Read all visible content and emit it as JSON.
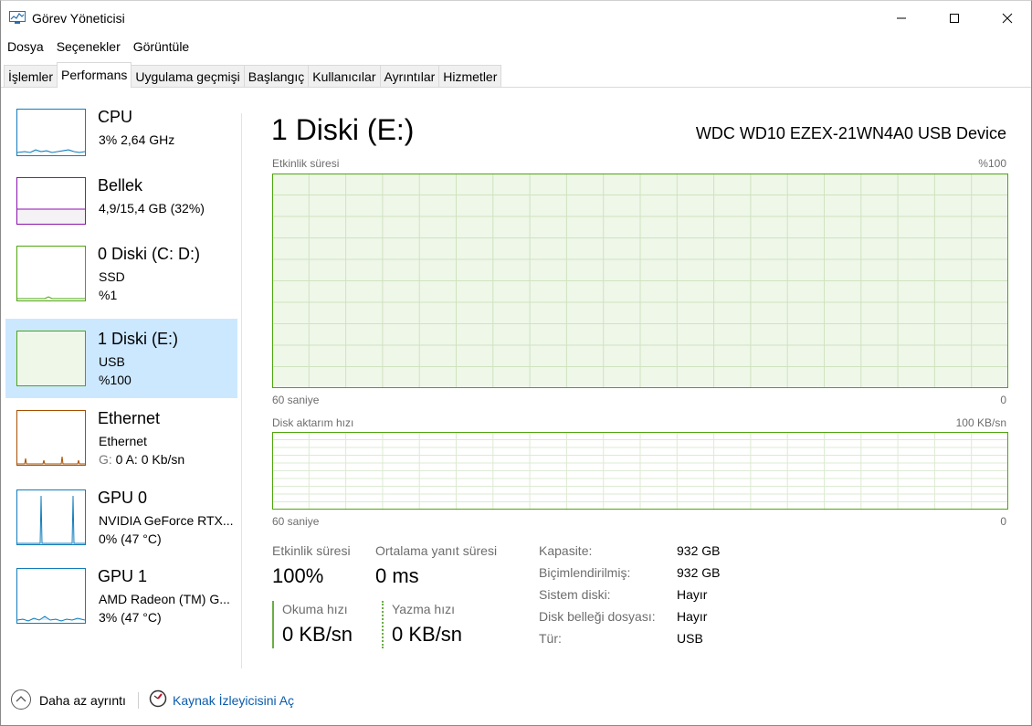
{
  "window": {
    "title": "Görev Yöneticisi"
  },
  "menu": [
    "Dosya",
    "Seçenekler",
    "Görüntüle"
  ],
  "tabs": [
    {
      "label": "İşlemler",
      "active": false
    },
    {
      "label": "Performans",
      "active": true
    },
    {
      "label": "Uygulama geçmişi",
      "active": false
    },
    {
      "label": "Başlangıç",
      "active": false
    },
    {
      "label": "Kullanıcılar",
      "active": false
    },
    {
      "label": "Ayrıntılar",
      "active": false
    },
    {
      "label": "Hizmetler",
      "active": false
    }
  ],
  "sidebar": {
    "items": [
      {
        "name": "CPU",
        "line1": "3% 2,64 GHz",
        "line2": "",
        "color": "#117dbb"
      },
      {
        "name": "Bellek",
        "line1": "4,9/15,4 GB (32%)",
        "line2": "",
        "color": "#8b12ae"
      },
      {
        "name": "0 Diski (C: D:)",
        "line1": "SSD",
        "line2": "%1",
        "color": "#4da60c"
      },
      {
        "name": "1 Diski (E:)",
        "line1": "USB",
        "line2": "%100",
        "color": "#4da60c",
        "selected": true
      },
      {
        "name": "Ethernet",
        "line1": "Ethernet",
        "line2_g": "G:",
        "line2_a": "0 A:",
        "line2_rest": "0 Kb/sn",
        "color": "#a74f01"
      },
      {
        "name": "GPU 0",
        "line1": "NVIDIA GeForce RTX...",
        "line2": "0% (47 °C)",
        "color": "#117dbb"
      },
      {
        "name": "GPU 1",
        "line1": "AMD Radeon (TM) G...",
        "line2": "3% (47 °C)",
        "color": "#117dbb"
      }
    ]
  },
  "main": {
    "title": "1 Diski (E:)",
    "device": "WDC WD10 EZEX-21WN4A0 USB Device",
    "graph1": {
      "label": "Etkinlik süresi",
      "max": "%100",
      "time_left": "60 saniye",
      "time_right": "0",
      "fill_percent": 100
    },
    "graph2": {
      "label": "Disk aktarım hızı",
      "max": "100 KB/sn",
      "time_left": "60 saniye",
      "time_right": "0"
    },
    "stats": {
      "active_label": "Etkinlik süresi",
      "active_value": "100%",
      "resp_label": "Ortalama yanıt süresi",
      "resp_value": "0 ms",
      "read_label": "Okuma hızı",
      "read_value": "0 KB/sn",
      "write_label": "Yazma hızı",
      "write_value": "0 KB/sn"
    },
    "properties": [
      {
        "label": "Kapasite:",
        "value": "932 GB"
      },
      {
        "label": "Biçimlendirilmiş:",
        "value": "932 GB"
      },
      {
        "label": "Sistem diski:",
        "value": "Hayır"
      },
      {
        "label": "Disk belleği dosyası:",
        "value": "Hayır"
      },
      {
        "label": "Tür:",
        "value": "USB"
      }
    ]
  },
  "footer": {
    "less_details": "Daha az ayrıntı",
    "resource_monitor": "Kaynak İzleyicisini Aç"
  },
  "colors": {
    "accent": "#cce8ff",
    "disk_green": "#4da60c",
    "graph_fill": "#eff7e9",
    "link": "#0b5cad"
  }
}
